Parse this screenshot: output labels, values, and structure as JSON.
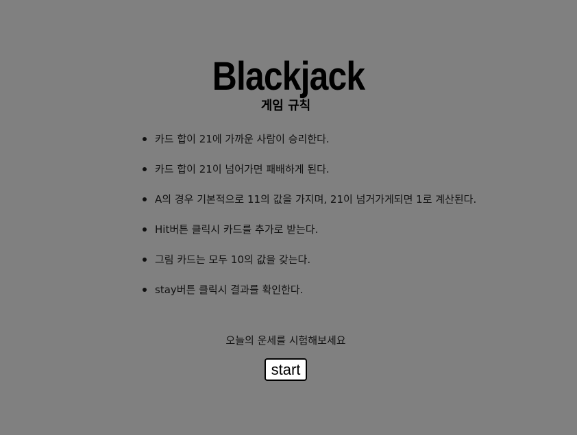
{
  "page": {
    "title": "Blackjack",
    "rules_heading": "게임 규칙",
    "rules": [
      "카드 합이 21에 가까운 사람이 승리한다.",
      "카드 합이 21이 넘어가면 패배하게 된다.",
      "A의 경우 기본적으로 11의 값을 가지며, 21이 넘거가게되면 1로 계산된다.",
      "Hit버튼 클릭시 카드를 추가로 받는다.",
      "그림 카드는 모두 10의 값을 갖는다.",
      "stay버튼 클릭시 결과를 확인한다."
    ],
    "fortune_text": "오늘의 운세를 시험해보세요",
    "start_button": "start"
  },
  "colors": {
    "background": "#808080",
    "text": "#111111",
    "button_background": "#ffffff",
    "button_border": "#000000"
  }
}
